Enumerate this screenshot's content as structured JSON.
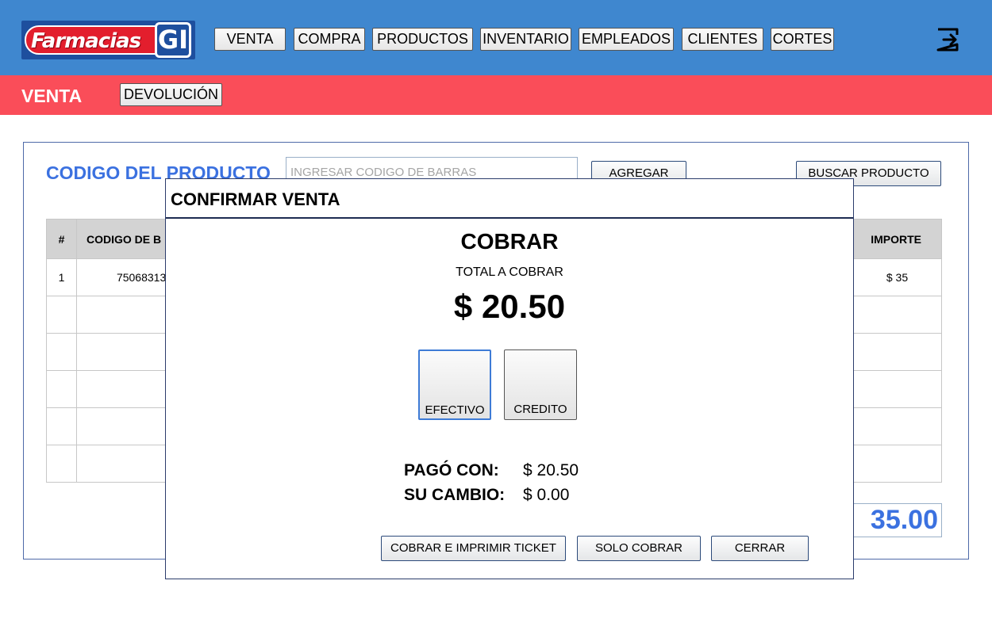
{
  "header": {
    "logo_text": "Farmacias",
    "logo_mark": "GI",
    "nav": [
      "VENTA",
      "COMPRA",
      "PRODUCTOS",
      "INVENTARIO",
      "EMPLEADOS",
      "CLIENTES",
      "CORTES"
    ],
    "logout_icon": "logout-icon"
  },
  "subheader": {
    "title": "VENTA",
    "devolucion_label": "DEVOLUCIÓN"
  },
  "product": {
    "code_label": "CODIGO DEL PRODUCTO",
    "code_placeholder": "INGRESAR CODIGO DE BARRAS",
    "add_label": "AGREGAR",
    "search_label": "BUSCAR PRODUCTO"
  },
  "table": {
    "columns": [
      "#",
      "CODIGO DE B",
      "IMPORTE"
    ],
    "rows": [
      {
        "num": "1",
        "code": "75068313",
        "importe": "$ 35"
      }
    ],
    "total": "35.00"
  },
  "modal": {
    "title": "CONFIRMAR VENTA",
    "heading": "COBRAR",
    "total_label": "TOTAL A COBRAR",
    "total_amount": "$ 20.50",
    "efectivo_label": "EFECTIVO",
    "credito_label": "CREDITO",
    "pago_label": "PAGÓ CON:",
    "pago_value": "$ 20.50",
    "cambio_label": "SU CAMBIO:",
    "cambio_value": "$ 0.00",
    "btn_imprimir": "COBRAR E IMPRIMIR TICKET",
    "btn_solo": "SOLO COBRAR",
    "btn_cerrar": "CERRAR"
  },
  "colors": {
    "topbar": "#3f87cf",
    "subbar": "#fa4d59",
    "accent_text": "#3b71e0"
  }
}
